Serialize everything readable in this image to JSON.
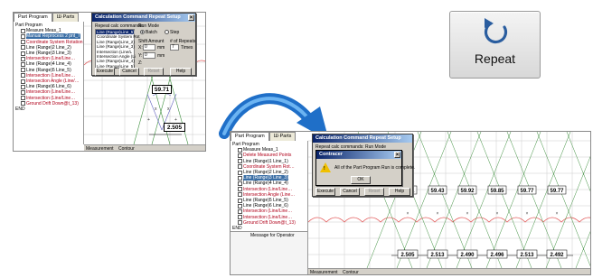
{
  "left_window": {
    "tabs": [
      "Part Program",
      "Ш·Parts"
    ],
    "tree": [
      {
        "label": "Part Program",
        "style": "normal",
        "checked": false
      },
      {
        "label": "Measure Meas_1",
        "style": "normal",
        "checked": true
      },
      {
        "label": "Manual Reprocess 2 pnt_7",
        "style": "selected",
        "checked": true
      },
      {
        "label": "Coordinate System Rotation 1(…",
        "style": "red",
        "checked": true
      },
      {
        "label": "Line (Range)2 Line_2)",
        "style": "normal",
        "checked": true
      },
      {
        "label": "Line (Range)3 Line_3)",
        "style": "normal",
        "checked": true
      },
      {
        "label": "Intersection (Line/Line…",
        "style": "red",
        "checked": true
      },
      {
        "label": "Line (Range)4 Line_4)",
        "style": "normal",
        "checked": true
      },
      {
        "label": "Line (Range)5 Line_5)",
        "style": "normal",
        "checked": true
      },
      {
        "label": "Intersection (Line/Line…",
        "style": "red",
        "checked": true
      },
      {
        "label": "Intersection Angle (Line/…",
        "style": "red",
        "checked": true
      },
      {
        "label": "Line (Range)6 Line_6)",
        "style": "normal",
        "checked": true
      },
      {
        "label": "Intersection (Line/Line…",
        "style": "red",
        "checked": true
      },
      {
        "label": "Intersection (Line/Line…",
        "style": "red",
        "checked": true
      },
      {
        "label": "Ground Drift Down@t_13)",
        "style": "red",
        "checked": true
      },
      {
        "label": "END",
        "style": "normal",
        "checked": false
      }
    ],
    "dialog": {
      "title": "Calculation Command Repeat Setup",
      "close_symbol": "×",
      "repeat_cmds_label": "Repeat calc commands:",
      "list": [
        "Line (Range)Line_5)",
        "Coordinate System Rot",
        "Line (Range)Line_2)",
        "Line (Range)Line_3)",
        "Intersection (Line/L",
        "Intersection Angle (Li",
        "Line (Range)Line_4)",
        "Line (Range)Line_5)"
      ],
      "run_mode_label": "Run Mode",
      "radio_batch": "Batch",
      "radio_step": "Step",
      "shift_amount_label": "Shift Amount",
      "repeats_label": "# of Repeats",
      "x_label": "X:",
      "x_value": "0",
      "y_label": "Y:",
      "y_value": "0",
      "z_label": "Z:",
      "mm1": "mm",
      "mm2": "mm",
      "times_value": "7",
      "times_label": "Times",
      "execute": "Execute",
      "cancel": "Cancel",
      "reset": "Reset",
      "help": "Help"
    },
    "dim_angle": "59.71",
    "dim_pitch": "2.505",
    "status_tabs": [
      "Measurement",
      "Contour"
    ]
  },
  "repeat_button": {
    "label": "Repeat",
    "icon": "repeat-arrow-icon",
    "icon_color": "#2a5d9f"
  },
  "arrow_color": "#1f6fc8",
  "right_window": {
    "tabs": [
      "Part Program",
      "Ш·Parts"
    ],
    "tree": [
      {
        "label": "Part Program",
        "style": "normal",
        "checked": false
      },
      {
        "label": "Measure Meas_1",
        "style": "normal",
        "checked": true
      },
      {
        "label": "Delete Measured Points",
        "style": "red",
        "checked": true
      },
      {
        "label": "Line (Range)1 Line_1)",
        "style": "normal",
        "checked": true
      },
      {
        "label": "Coordinate System Rot…",
        "style": "red",
        "checked": true
      },
      {
        "label": "Line (Range)2 Line_2)",
        "style": "normal",
        "checked": true
      },
      {
        "label": "Line (Range)3 Line_3)",
        "style": "selected",
        "checked": true
      },
      {
        "label": "Line (Range)4 Line_4)",
        "style": "normal",
        "checked": true
      },
      {
        "label": "Intersection (Line/Line…",
        "style": "red",
        "checked": true
      },
      {
        "label": "Intersection Angle (Line…",
        "style": "red",
        "checked": true
      },
      {
        "label": "Line (Range)5 Line_5)",
        "style": "normal",
        "checked": true
      },
      {
        "label": "Line (Range)6 Line_6)",
        "style": "normal",
        "checked": true
      },
      {
        "label": "Intersection (Line/Line…",
        "style": "red",
        "checked": true
      },
      {
        "label": "Intersection (Line/Line…",
        "style": "red",
        "checked": true
      },
      {
        "label": "Ground Drift Down@t_13)",
        "style": "red",
        "checked": true
      },
      {
        "label": "END",
        "style": "normal",
        "checked": false
      }
    ],
    "message_panel": "Message for Operator",
    "bg_dialog": {
      "title": "Calculation Command Repeat Setup",
      "repeat_cmds_label": "Repeat calc commands:",
      "run_mode_label": "Run Mode",
      "execute": "Execute",
      "cancel": "Cancel",
      "reset": "Reset",
      "help": "Help"
    },
    "popup": {
      "title": "Contracer",
      "close_symbol": "×",
      "warning_symbol": "!",
      "message": "All of the Part Program Run is complete.",
      "ok": "OK"
    },
    "angles": [
      "59.71",
      "59.43",
      "59.92",
      "59.85",
      "59.77",
      "59.77"
    ],
    "pitches": [
      "2.505",
      "2.513",
      "2.490",
      "2.496",
      "2.513",
      "2.492"
    ],
    "status_tabs": [
      "Measurement",
      "Contour"
    ]
  }
}
